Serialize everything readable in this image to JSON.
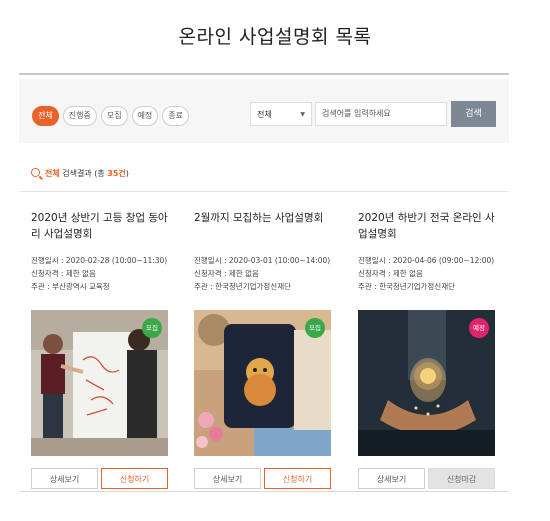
{
  "page_title": "온라인 사업설명회 목록",
  "filter_tabs": [
    {
      "label": "전체",
      "active": true
    },
    {
      "label": "진행중",
      "active": false
    },
    {
      "label": "모집",
      "active": false
    },
    {
      "label": "예정",
      "active": false
    },
    {
      "label": "종료",
      "active": false
    }
  ],
  "search": {
    "select_value": "전체",
    "placeholder": "검색어를 입력하세요",
    "button_label": "검색"
  },
  "result": {
    "prefix": "전체",
    "mid": " 검색결과 (총 ",
    "count": "35건",
    "suffix": ")"
  },
  "cards": [
    {
      "title": "2020년 상반기 고등 창업 동아리 사업설명회",
      "date": "진행일시 : 2020-02-28 (10:00~11:30)",
      "eligibility": "신청자격 : 제한 없음",
      "host": "주관 : 부산광역시 교육청",
      "badge": "모집",
      "badge_color": "#3aa848",
      "detail_label": "상세보기",
      "action_label": "신청하기",
      "action_state": "apply"
    },
    {
      "title": "2월까지 모집하는 사업설명회",
      "date": "진행일시 : 2020-03-01 (10:00~14:00)",
      "eligibility": "신청자격 : 제한 없음",
      "host": "주관 : 한국청년기업가정신재단",
      "badge": "모집",
      "badge_color": "#3aa848",
      "detail_label": "상세보기",
      "action_label": "신청하기",
      "action_state": "apply"
    },
    {
      "title": "2020년 하반기 전국 온라인 사업설명회",
      "date": "진행일시 : 2020-04-06 (09:00~12:00)",
      "eligibility": "신청자격 : 제한 없음",
      "host": "주관 : 한국청년기업가정신재단",
      "badge": "예정",
      "badge_color": "#e0236b",
      "detail_label": "상세보기",
      "action_label": "신청마감",
      "action_state": "closed"
    }
  ]
}
